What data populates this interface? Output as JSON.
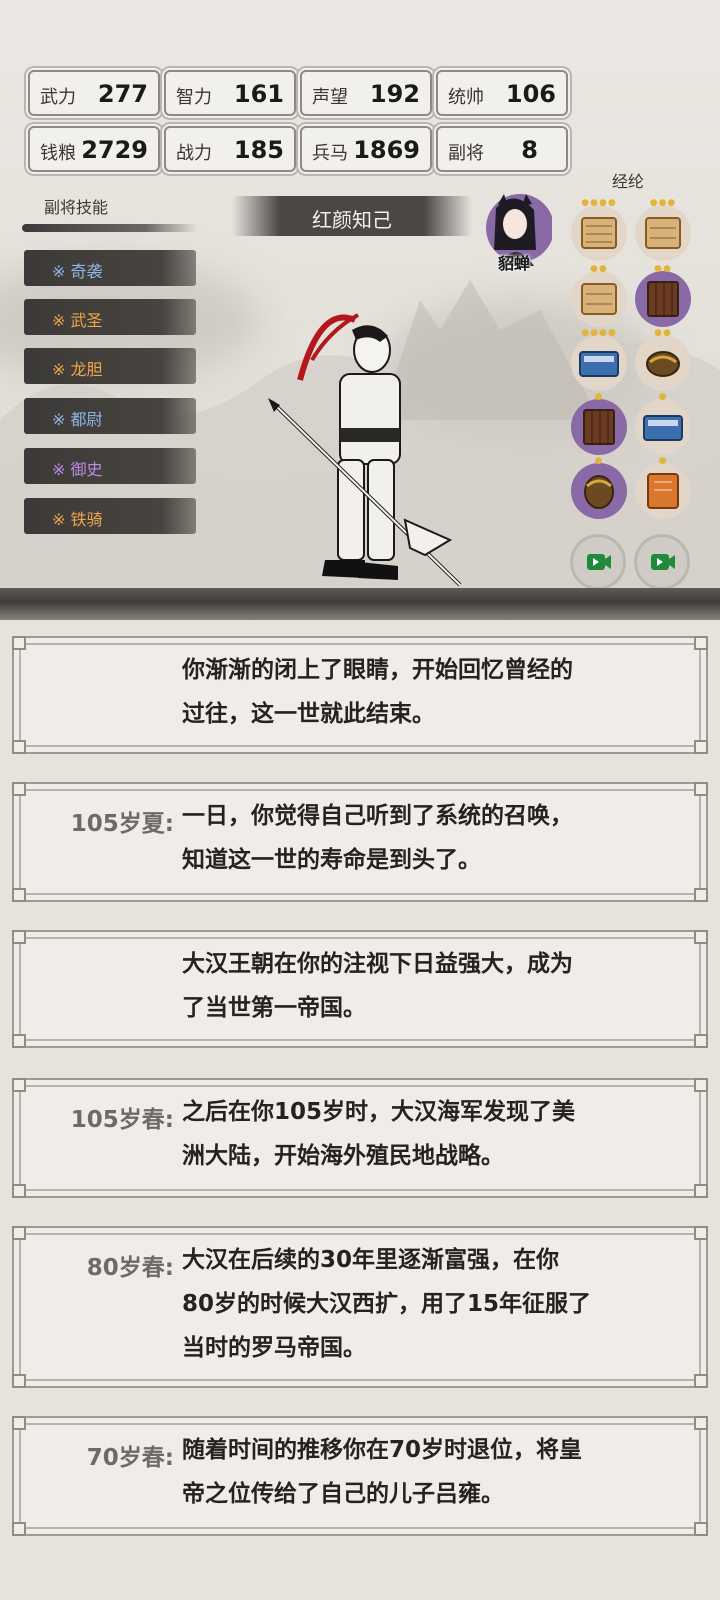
{
  "stats": [
    {
      "label": "武力",
      "value": "277"
    },
    {
      "label": "智力",
      "value": "161"
    },
    {
      "label": "声望",
      "value": "192"
    },
    {
      "label": "统帅",
      "value": "106"
    },
    {
      "label": "钱粮",
      "value": "2729"
    },
    {
      "label": "战力",
      "value": "185"
    },
    {
      "label": "兵马",
      "value": "1869"
    },
    {
      "label": "副将",
      "value": "8"
    }
  ],
  "skills": {
    "title": "副将技能",
    "items": [
      {
        "label": "※ 奇袭",
        "color": "#8fb6e6"
      },
      {
        "label": "※ 武圣",
        "color": "#f0a64a"
      },
      {
        "label": "※ 龙胆",
        "color": "#f0a64a"
      },
      {
        "label": "※ 都尉",
        "color": "#8fb6e6"
      },
      {
        "label": "※ 御史",
        "color": "#c08be6"
      },
      {
        "label": "※ 铁骑",
        "color": "#f0a64a"
      }
    ]
  },
  "banner": "红颜知己",
  "portrait": {
    "name": "貂蝉"
  },
  "lunjing": {
    "title": "经纶"
  },
  "log": [
    {
      "age": "",
      "lines": [
        "你渐渐的闭上了眼睛，开始回忆曾经的",
        "过往，这一世就此结束。"
      ]
    },
    {
      "age": "105岁夏:",
      "lines": [
        "一日，你觉得自己听到了系统的召唤，",
        "知道这一世的寿命是到头了。"
      ]
    },
    {
      "age": "",
      "lines": [
        "大汉王朝在你的注视下日益强大，成为",
        "了当世第一帝国。"
      ]
    },
    {
      "age": "105岁春:",
      "lines": [
        "之后在你105岁时，大汉海军发现了美",
        "洲大陆，开始海外殖民地战略。"
      ]
    },
    {
      "age": "80岁春:",
      "lines": [
        "大汉在后续的30年里逐渐富强，在你",
        "80岁的时候大汉西扩，用了15年征服了",
        "当时的罗马帝国。"
      ]
    },
    {
      "age": "70岁春:",
      "lines": [
        "随着时间的推移你在70岁时退位，将皇",
        "帝之位传给了自己的儿子吕雍。"
      ]
    }
  ]
}
